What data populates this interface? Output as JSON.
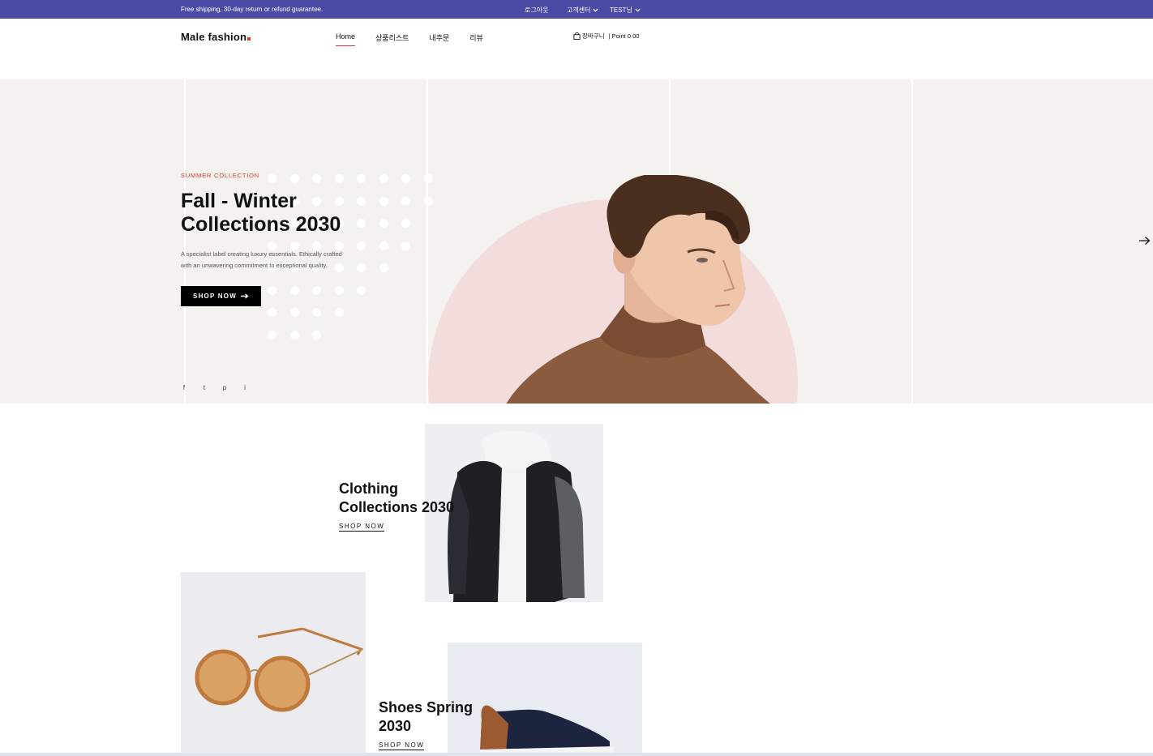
{
  "topbar": {
    "promo": "Free shipping, 30-day return or refund guarantee.",
    "logout": "로그아웃",
    "customer_center": "고객센터",
    "user": "TEST님"
  },
  "header": {
    "logo": "Male fashion",
    "nav": [
      "Home",
      "상품리스트",
      "내주문",
      "리뷰"
    ],
    "cart_label": "장바구니",
    "point_label": "| Point 0.00"
  },
  "hero": {
    "subtitle": "SUMMER COLLECTION",
    "title_line1": "Fall - Winter",
    "title_line2": "Collections 2030",
    "desc_line1": "A specialist label creating luxury essentials. Ethically crafted",
    "desc_line2": "with an unwavering commitment to exceptional quality.",
    "button": "SHOP NOW",
    "socials": [
      "f",
      "t",
      "p",
      "i"
    ]
  },
  "banners": {
    "clothing_title_1": "Clothing",
    "clothing_title_2": "Collections 2030",
    "clothing_link": "SHOP NOW",
    "shoes_title_1": "Shoes Spring",
    "shoes_title_2": "2030",
    "shoes_link": "SHOP NOW"
  },
  "colors": {
    "topbar": "#4b4ba6",
    "accent": "#e53637",
    "hero_bg": "#f3f2ee"
  }
}
